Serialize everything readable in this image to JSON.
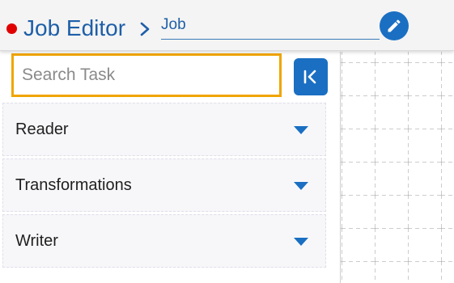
{
  "header": {
    "title": "Job Editor",
    "job_name": "Job",
    "status_color": "#e00000",
    "icons": {
      "status": "status-dot",
      "separator": "chevron-right-icon",
      "edit": "pencil-icon"
    }
  },
  "sidebar": {
    "search_placeholder": "Search Task",
    "collapse_icon": "collapse-left-icon",
    "accordion": [
      {
        "label": "Reader",
        "icon": "caret-down-icon"
      },
      {
        "label": "Transformations",
        "icon": "caret-down-icon"
      },
      {
        "label": "Writer",
        "icon": "caret-down-icon"
      }
    ]
  },
  "colors": {
    "accent_blue": "#1a6fc2",
    "title_blue": "#1e5fa8",
    "search_focus": "#f0a500"
  }
}
